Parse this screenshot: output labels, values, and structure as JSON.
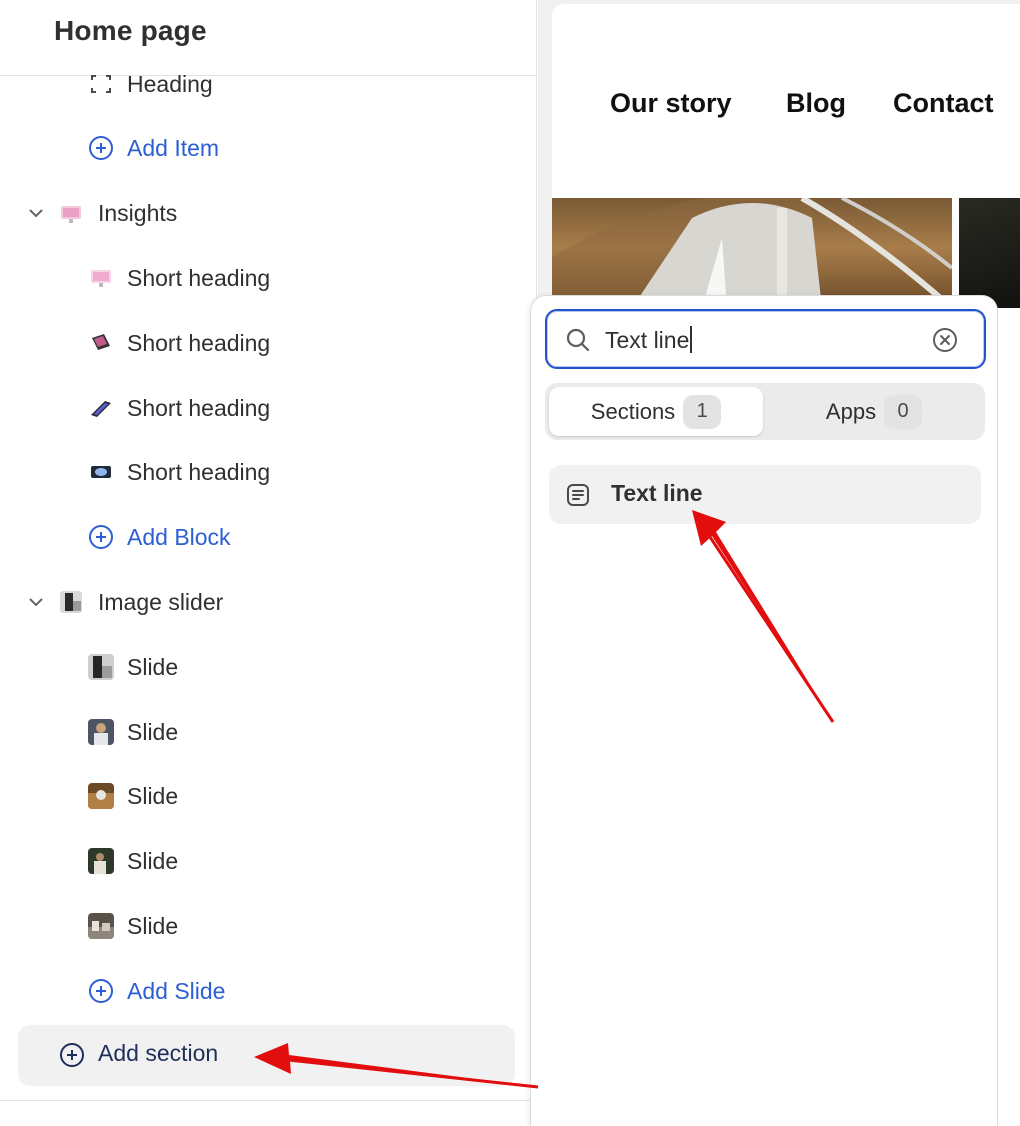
{
  "sidebar": {
    "title": "Home page",
    "rows": {
      "heading": "Heading",
      "add_item": "Add Item",
      "insights": "Insights",
      "short_heading_1": "Short heading",
      "short_heading_2": "Short heading",
      "short_heading_3": "Short heading",
      "short_heading_4": "Short heading",
      "add_block": "Add Block",
      "image_slider": "Image slider",
      "slide_1": "Slide",
      "slide_2": "Slide",
      "slide_3": "Slide",
      "slide_4": "Slide",
      "slide_5": "Slide",
      "add_slide": "Add Slide"
    },
    "add_section_label": "Add section"
  },
  "preview": {
    "nav": [
      "Our story",
      "Blog",
      "Contact"
    ]
  },
  "popover": {
    "search_value": "Text line",
    "tabs": [
      {
        "label": "Sections",
        "count": "1"
      },
      {
        "label": "Apps",
        "count": "0"
      }
    ],
    "results": [
      {
        "label": "Text line"
      }
    ]
  },
  "icons": {
    "chevron": "chevron-down-icon",
    "add": "plus-circle-icon",
    "search": "search-icon",
    "clear": "clear-circle-icon",
    "result": "text-block-icon",
    "heading": "heading-block-icon"
  },
  "colors": {
    "link_blue": "#2c5fd4",
    "focus_border": "#2552c9",
    "annotation_arrow": "#e20d0d"
  }
}
